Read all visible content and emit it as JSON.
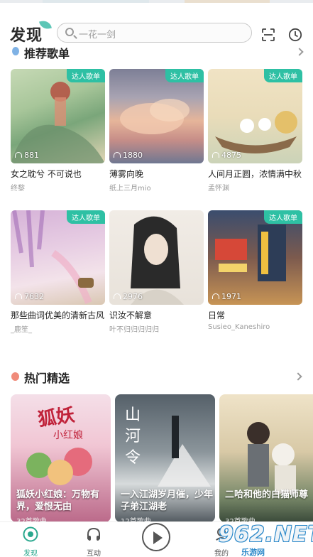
{
  "header": {
    "logo": "发现",
    "search_placeholder": "一花一剑",
    "icons": [
      "scan-icon",
      "history-clock-icon"
    ]
  },
  "recommended": {
    "title": "推荐歌单",
    "cards": [
      {
        "title": "女之耽兮 不可说也",
        "author": "终黎",
        "plays": "881",
        "badge": "达人歌单"
      },
      {
        "title": "薄雾向晚",
        "author": "纸上三月mio",
        "plays": "1880",
        "badge": "达人歌单"
      },
      {
        "title": "人间月正圆，浓情满中秋",
        "author": "孟怀渊",
        "plays": "4875",
        "badge": "达人歌单"
      },
      {
        "title": "那些曲词优美的清新古风",
        "author": "_鹿笙_",
        "plays": "7632",
        "badge": "达人歌单"
      },
      {
        "title": "识汝不解意",
        "author": "叶不归归归归归",
        "plays": "2976",
        "badge": ""
      },
      {
        "title": "日常",
        "author": "Susieo_Kaneshiro",
        "plays": "1971",
        "badge": "达人歌单"
      }
    ]
  },
  "hot": {
    "title": "热门精选",
    "items": [
      {
        "title": "狐妖小红娘：万物有界，爱恨无由",
        "sub": "32首歌曲"
      },
      {
        "title": "一入江湖岁月催，少年子弟江湖老",
        "sub": "12首歌曲"
      },
      {
        "title": "二哈和他的白猫师尊",
        "sub": "32首歌曲"
      }
    ]
  },
  "tabbar": {
    "tabs": [
      {
        "label": "发现",
        "active": true
      },
      {
        "label": "互动",
        "active": false
      },
      {
        "label": "我的",
        "active": false
      }
    ]
  },
  "watermark": {
    "big": "962.NET",
    "small": "乐游网"
  },
  "colors": {
    "accent": "#2ec0a4",
    "active_tab": "#2aa88e"
  }
}
